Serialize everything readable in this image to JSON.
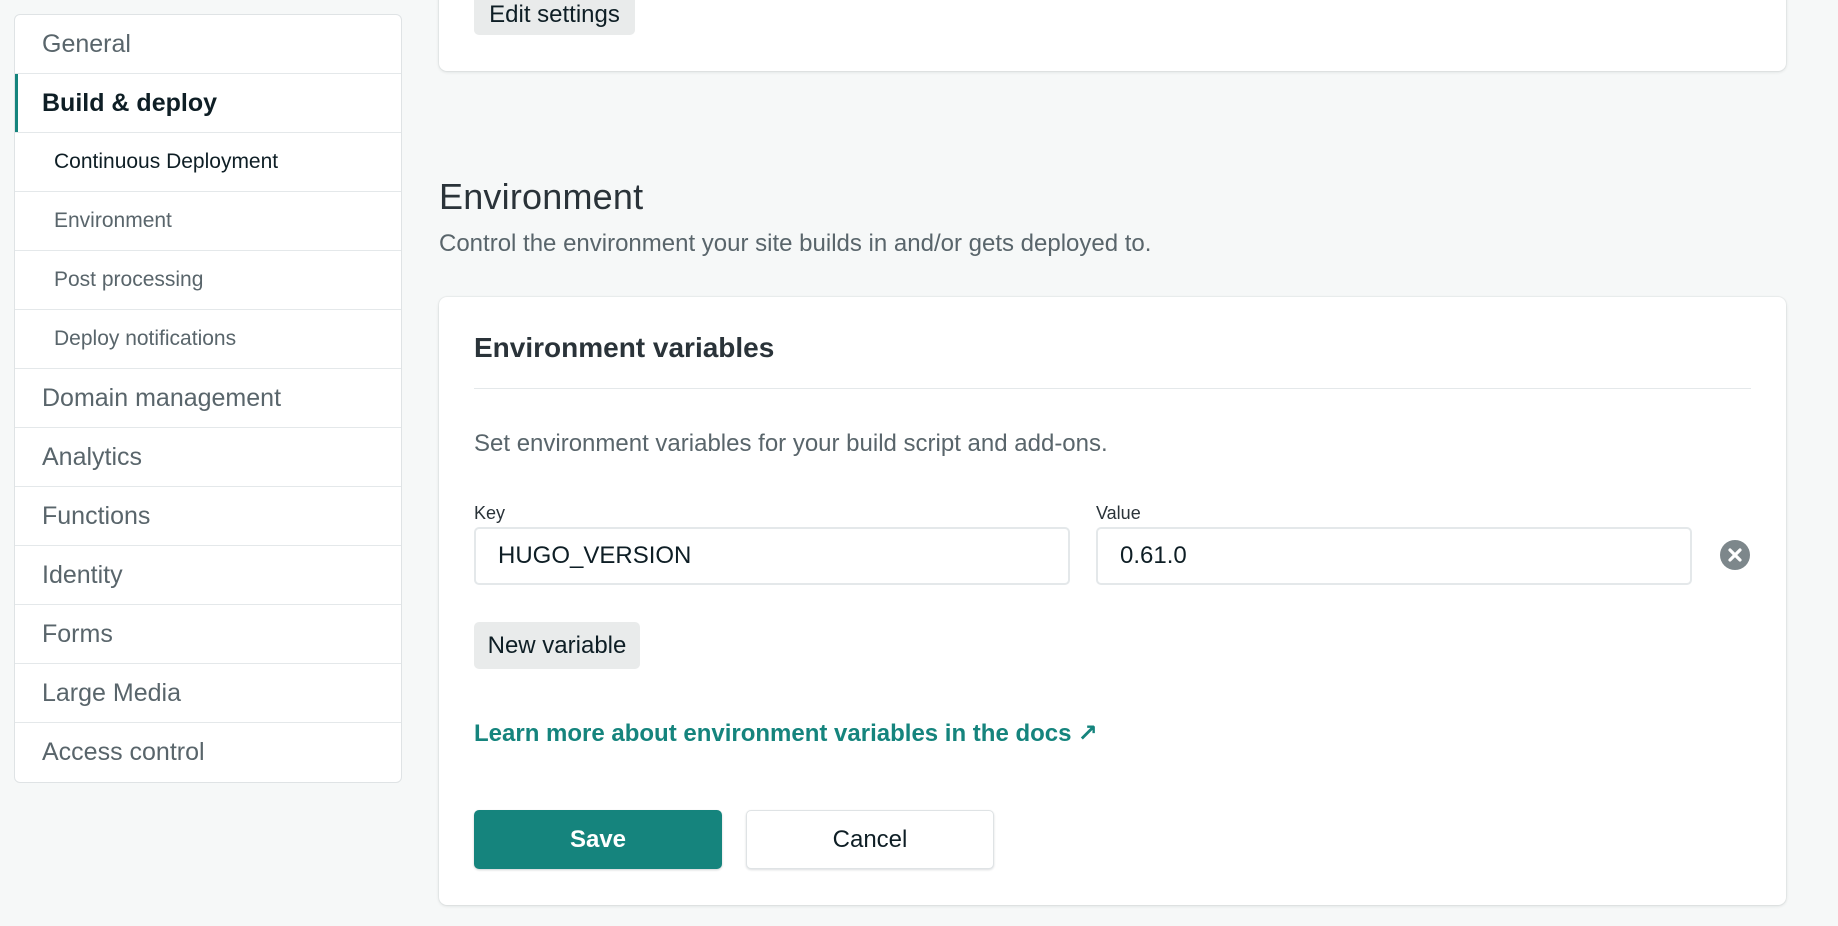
{
  "sidebar": {
    "items": [
      {
        "label": "General"
      },
      {
        "label": "Build & deploy"
      },
      {
        "label": "Domain management"
      },
      {
        "label": "Analytics"
      },
      {
        "label": "Functions"
      },
      {
        "label": "Identity"
      },
      {
        "label": "Forms"
      },
      {
        "label": "Large Media"
      },
      {
        "label": "Access control"
      }
    ],
    "subitems": [
      {
        "label": "Continuous Deployment"
      },
      {
        "label": "Environment"
      },
      {
        "label": "Post processing"
      },
      {
        "label": "Deploy notifications"
      }
    ]
  },
  "top_card": {
    "edit_label": "Edit settings"
  },
  "environment": {
    "title": "Environment",
    "description": "Control the environment your site builds in and/or gets deployed to.",
    "card": {
      "title": "Environment variables",
      "help": "Set environment variables for your build script and add-ons.",
      "key_label": "Key",
      "value_label": "Value",
      "key_value": "HUGO_VERSION",
      "value_value": "0.61.0",
      "new_variable_label": "New variable",
      "docs_link_label": "Learn more about environment variables in the docs",
      "docs_link_arrow": "↗",
      "save_label": "Save",
      "cancel_label": "Cancel"
    }
  },
  "colors": {
    "accent": "#15847d",
    "text_dark": "#0e1e25",
    "text_muted": "#59656b",
    "background": "#f6f8f8",
    "card": "#ffffff",
    "border": "#e4e8ea",
    "gray_button": "#e9ebeb",
    "remove_icon": "#7d878b"
  }
}
